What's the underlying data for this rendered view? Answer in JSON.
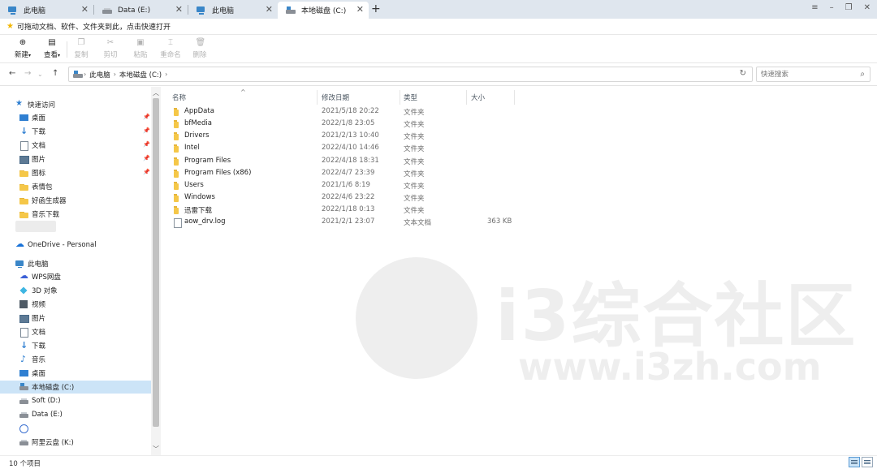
{
  "tabs": [
    {
      "label": "此电脑",
      "icon": "pc-icon"
    },
    {
      "label": "Data (E:)",
      "icon": "drive-icon"
    },
    {
      "label": "此电脑",
      "icon": "pc-icon"
    },
    {
      "label": "本地磁盘 (C:)",
      "icon": "system-drive-icon"
    }
  ],
  "hint": "可拖动文档、软件、文件夹到此，点击快速打开",
  "ribbon": {
    "new": "新建",
    "view": "查看",
    "copy": "复制",
    "cut": "剪切",
    "paste": "粘贴",
    "rename": "重命名",
    "delete": "删除"
  },
  "breadcrumb": [
    "此电脑",
    "本地磁盘 (C:)"
  ],
  "search": {
    "placeholder": "快速搜索"
  },
  "sidebar": {
    "quick_access": "快速访问",
    "quick_items": [
      {
        "label": "桌面",
        "icon": "desktop-icon",
        "pinned": true
      },
      {
        "label": "下载",
        "icon": "download-icon",
        "pinned": true
      },
      {
        "label": "文档",
        "icon": "document-icon",
        "pinned": true
      },
      {
        "label": "图片",
        "icon": "picture-icon",
        "pinned": true
      },
      {
        "label": "图标",
        "icon": "folder-icon",
        "pinned": true
      },
      {
        "label": "表情包",
        "icon": "folder-icon",
        "pinned": false
      },
      {
        "label": "好函生成器",
        "icon": "folder-icon",
        "pinned": false
      },
      {
        "label": "音乐下载",
        "icon": "folder-icon",
        "pinned": false
      }
    ],
    "onedrive": "OneDrive - Personal",
    "this_pc": "此电脑",
    "pc_items": [
      {
        "label": "WPS网盘",
        "icon": "cloud-icon"
      },
      {
        "label": "3D 对象",
        "icon": "3d-objects-icon"
      },
      {
        "label": "视频",
        "icon": "video-icon"
      },
      {
        "label": "图片",
        "icon": "picture-icon"
      },
      {
        "label": "文档",
        "icon": "document-icon"
      },
      {
        "label": "下载",
        "icon": "download-icon"
      },
      {
        "label": "音乐",
        "icon": "music-icon"
      },
      {
        "label": "桌面",
        "icon": "desktop-icon"
      },
      {
        "label": "本地磁盘 (C:)",
        "icon": "system-drive-icon",
        "selected": true
      },
      {
        "label": "Soft (D:)",
        "icon": "drive-icon"
      },
      {
        "label": "Data (E:)",
        "icon": "drive-icon"
      },
      {
        "label": "",
        "icon": "circle-app-icon"
      },
      {
        "label": "阿里云盘 (K:)",
        "icon": "drive-icon"
      }
    ]
  },
  "columns": {
    "name": "名称",
    "date": "修改日期",
    "type": "类型",
    "size": "大小"
  },
  "files": [
    {
      "name": "AppData",
      "date": "2021/5/18 20:22",
      "type": "文件夹",
      "size": "",
      "kind": "folder"
    },
    {
      "name": "bfMedia",
      "date": "2022/1/8 23:05",
      "type": "文件夹",
      "size": "",
      "kind": "folder"
    },
    {
      "name": "Drivers",
      "date": "2021/2/13 10:40",
      "type": "文件夹",
      "size": "",
      "kind": "folder"
    },
    {
      "name": "Intel",
      "date": "2022/4/10 14:46",
      "type": "文件夹",
      "size": "",
      "kind": "folder"
    },
    {
      "name": "Program Files",
      "date": "2022/4/18 18:31",
      "type": "文件夹",
      "size": "",
      "kind": "folder"
    },
    {
      "name": "Program Files (x86)",
      "date": "2022/4/7 23:39",
      "type": "文件夹",
      "size": "",
      "kind": "folder"
    },
    {
      "name": "Users",
      "date": "2021/1/6 8:19",
      "type": "文件夹",
      "size": "",
      "kind": "folder"
    },
    {
      "name": "Windows",
      "date": "2022/4/6 23:22",
      "type": "文件夹",
      "size": "",
      "kind": "folder"
    },
    {
      "name": "迅雷下载",
      "date": "2022/1/18 0:13",
      "type": "文件夹",
      "size": "",
      "kind": "folder"
    },
    {
      "name": "aow_drv.log",
      "date": "2021/2/1 23:07",
      "type": "文本文档",
      "size": "363 KB",
      "kind": "file"
    }
  ],
  "watermark": {
    "text": "i3综合社区",
    "url": "www.i3zh.com"
  },
  "status": "10 个项目",
  "colors": {
    "accent": "#2f7fd1",
    "selected": "#cce4f7",
    "folder": "#f5c748",
    "tabbar": "#dfe6ee"
  }
}
